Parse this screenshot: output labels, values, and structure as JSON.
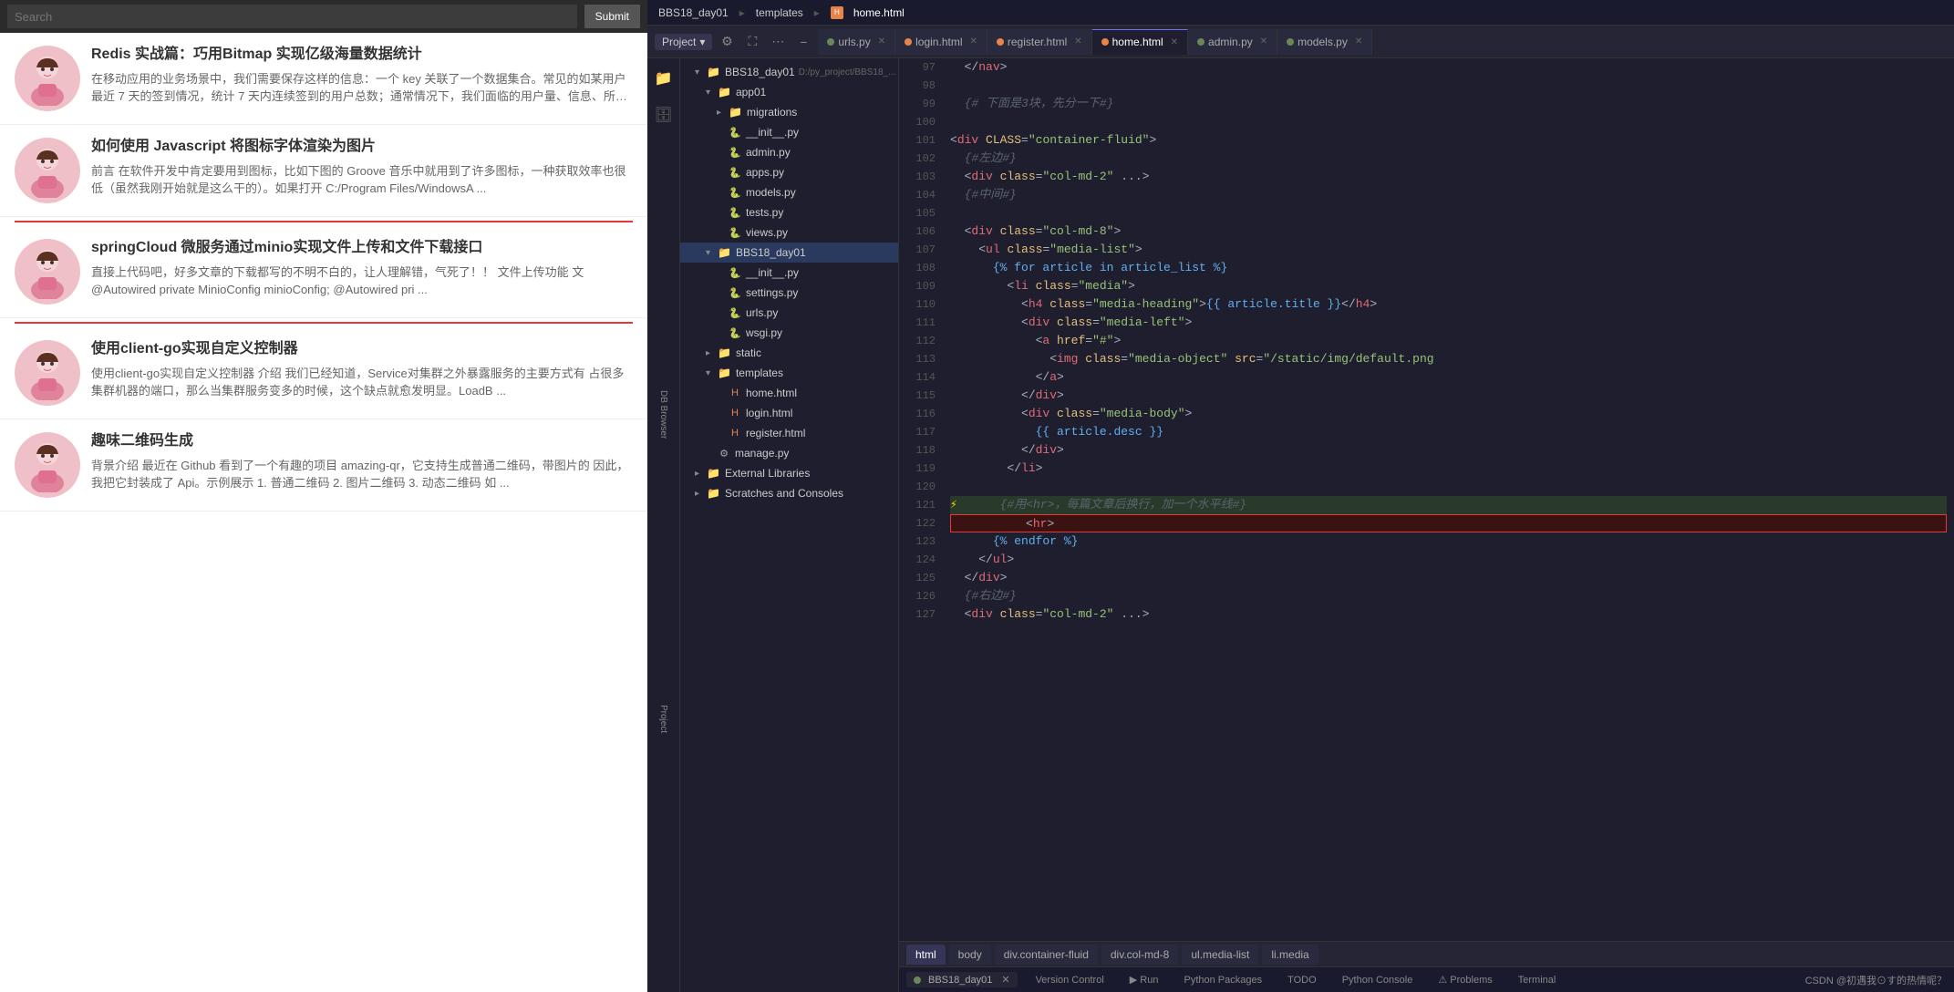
{
  "leftPanel": {
    "searchPlaceholder": "Search",
    "submitBtn": "Submit",
    "articles": [
      {
        "title": "Redis 实战篇：巧用Bitmap 实现亿级海量数据统计",
        "desc": "在移动应用的业务场景中，我们需要保存这样的信息：一个 key 关联了一个数据集合。常见的如某用户最近 7 天的签到情况，统计 7 天内连续签到的用户总数；通常情况下，我们面临的用户量、信息、所以，我们必须"
      },
      {
        "title": "如何使用 Javascript 将图标字体渲染为图片",
        "desc": "前言 在软件开发中肯定要用到图标，比如下图的 Groove 音乐中就用到了许多图标，一种获取效率也很低（虽然我刚开始就是这么干的）。如果打开 C:/Program Files/WindowsA ..."
      },
      {
        "title": "springCloud 微服务通过minio实现文件上传和文件下载接口",
        "desc": "直接上代码吧，好多文章的下载都写的不明不白的，让人理解错，气死了！！ 文件上传功能 文 @Autowired private MinioConfig minioConfig; @Autowired pri ..."
      },
      {
        "title": "使用client-go实现自定义控制器",
        "desc": "使用client-go实现自定义控制器 介绍 我们已经知道，Service对集群之外暴露服务的主要方式有 占很多集群机器的端口，那么当集群服务变多的时候，这个缺点就愈发明显。LoadB ..."
      },
      {
        "title": "趣味二维码生成",
        "desc": "背景介绍 最近在 Github 看到了一个有趣的项目 amazing-qr，它支持生成普通二维码，带图片的 因此，我把它封装成了 Api。示例展示 1. 普通二维码 2. 图片二维码 3. 动态二维码 如 ..."
      }
    ]
  },
  "ide": {
    "breadcrumbs": [
      "BBS18_day01",
      "templates",
      "home.html"
    ],
    "tabs": [
      {
        "label": "urls.py",
        "type": "py",
        "active": false
      },
      {
        "label": "login.html",
        "type": "html",
        "active": false
      },
      {
        "label": "register.html",
        "type": "html",
        "active": false
      },
      {
        "label": "home.html",
        "type": "html",
        "active": true
      },
      {
        "label": "admin.py",
        "type": "py",
        "active": false
      },
      {
        "label": "models.py",
        "type": "py",
        "active": false
      }
    ],
    "projectBtn": "Project",
    "fileTree": {
      "root": "BBS18_day01",
      "rootPath": "D:/py_project/BBS18_...",
      "items": [
        {
          "label": "app01",
          "type": "folder",
          "indent": 1,
          "expanded": true
        },
        {
          "label": "migrations",
          "type": "folder",
          "indent": 2,
          "expanded": false
        },
        {
          "label": "__init__.py",
          "type": "py",
          "indent": 3
        },
        {
          "label": "admin.py",
          "type": "py",
          "indent": 3
        },
        {
          "label": "apps.py",
          "type": "py",
          "indent": 3
        },
        {
          "label": "models.py",
          "type": "py",
          "indent": 3
        },
        {
          "label": "tests.py",
          "type": "py",
          "indent": 3
        },
        {
          "label": "views.py",
          "type": "py",
          "indent": 3
        },
        {
          "label": "BBS18_day01",
          "type": "folder",
          "indent": 2,
          "expanded": true,
          "selected": true
        },
        {
          "label": "__init__.py",
          "type": "py",
          "indent": 3
        },
        {
          "label": "settings.py",
          "type": "py",
          "indent": 3
        },
        {
          "label": "urls.py",
          "type": "py",
          "indent": 3
        },
        {
          "label": "wsgi.py",
          "type": "py",
          "indent": 3
        },
        {
          "label": "static",
          "type": "folder",
          "indent": 2,
          "expanded": false
        },
        {
          "label": "templates",
          "type": "folder",
          "indent": 2,
          "expanded": true
        },
        {
          "label": "home.html",
          "type": "html",
          "indent": 3
        },
        {
          "label": "login.html",
          "type": "html",
          "indent": 3
        },
        {
          "label": "register.html",
          "type": "html",
          "indent": 3
        },
        {
          "label": "manage.py",
          "type": "py",
          "indent": 2
        },
        {
          "label": "External Libraries",
          "type": "folder-special",
          "indent": 1,
          "expanded": false
        },
        {
          "label": "Scratches and Consoles",
          "type": "folder-special",
          "indent": 1,
          "expanded": false
        }
      ]
    },
    "codeLines": [
      {
        "num": 97,
        "content": "  </nav>"
      },
      {
        "num": 98,
        "content": ""
      },
      {
        "num": 99,
        "content": "  {# 下面是3块，先分一下#}"
      },
      {
        "num": 100,
        "content": ""
      },
      {
        "num": 101,
        "content": "<div CLASS=\"container-fluid\">"
      },
      {
        "num": 102,
        "content": "  {#左边#}"
      },
      {
        "num": 103,
        "content": "  <div class=\"col-md-2\" ...>"
      },
      {
        "num": 104,
        "content": "  {#中间#}"
      },
      {
        "num": 105,
        "content": ""
      },
      {
        "num": 106,
        "content": "  <div class=\"col-md-8\">"
      },
      {
        "num": 107,
        "content": "    <ul class=\"media-list\">"
      },
      {
        "num": 108,
        "content": "      {% for article in article_list %}"
      },
      {
        "num": 109,
        "content": "        <li class=\"media\">"
      },
      {
        "num": 110,
        "content": "          <h4 class=\"media-heading\">{{ article.title }}</h4>"
      },
      {
        "num": 111,
        "content": "          <div class=\"media-left\">"
      },
      {
        "num": 112,
        "content": "            <a href=\"#\">"
      },
      {
        "num": 113,
        "content": "              <img class=\"media-object\" src=\"/static/img/default.png"
      },
      {
        "num": 114,
        "content": "            </a>"
      },
      {
        "num": 115,
        "content": "          </div>"
      },
      {
        "num": 116,
        "content": "          <div class=\"media-body\">"
      },
      {
        "num": 117,
        "content": "            {{ article.desc }}"
      },
      {
        "num": 118,
        "content": "          </div>"
      },
      {
        "num": 119,
        "content": "        </li>"
      },
      {
        "num": 120,
        "content": ""
      },
      {
        "num": 121,
        "content": "  ⚡      {#用<hr>，每篇文章后换行，加一个水平线#}"
      },
      {
        "num": 122,
        "content": "          <hr>",
        "errorHighlight": true
      },
      {
        "num": 123,
        "content": "      {% endfor %}"
      },
      {
        "num": 124,
        "content": "    </ul>"
      },
      {
        "num": 125,
        "content": "  </div>"
      },
      {
        "num": 126,
        "content": "  {#右边#}"
      },
      {
        "num": 127,
        "content": "  <div class=\"col-md-2\" ...>"
      }
    ],
    "bottomTabs": [
      "html",
      "body",
      "div.container-fluid",
      "div.col-md-8",
      "ul.media-list",
      "li.media"
    ],
    "bottomBar": {
      "runLabel": "BBS18_day01",
      "tabs": [
        "Version Control",
        "Run",
        "Python Packages",
        "TODO",
        "Python Console",
        "Problems",
        "Terminal"
      ]
    },
    "statusText": "CSDN @初遇我⊙す的热情呢？"
  }
}
